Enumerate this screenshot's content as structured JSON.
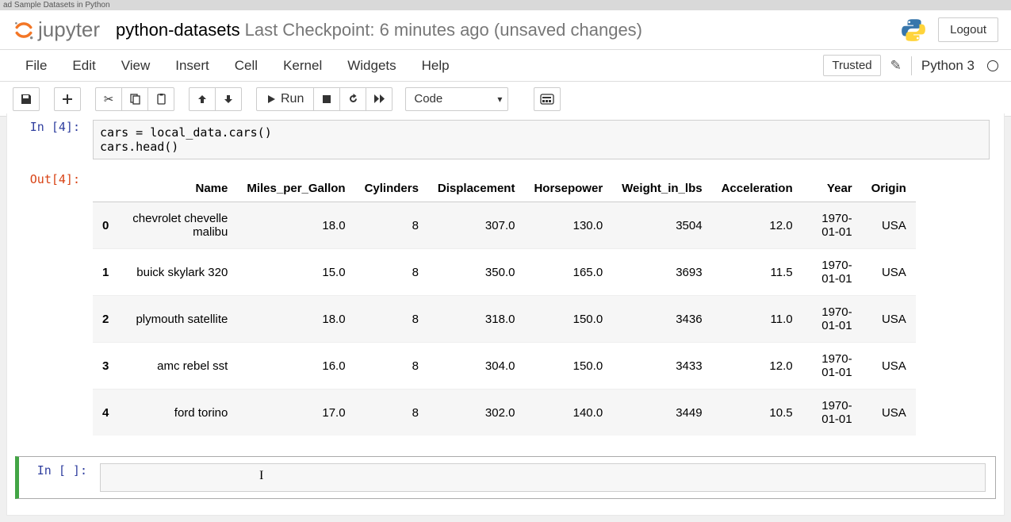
{
  "tab_strip": "ad Sample Datasets in Python",
  "header": {
    "logo_text": "jupyter",
    "notebook_name": "python-datasets",
    "checkpoint": "Last Checkpoint: 6 minutes ago  (unsaved changes)",
    "logout": "Logout"
  },
  "menubar": {
    "items": [
      "File",
      "Edit",
      "View",
      "Insert",
      "Cell",
      "Kernel",
      "Widgets",
      "Help"
    ],
    "trusted": "Trusted",
    "kernel": "Python 3"
  },
  "toolbar": {
    "run_label": "Run",
    "celltype": "Code"
  },
  "cells": {
    "in4_prompt": "In [4]:",
    "in4_code_line1": "cars = local_data.cars()",
    "in4_code_line2": "cars.head()",
    "out4_prompt": "Out[4]:",
    "empty_in_prompt": "In [ ]:"
  },
  "dataframe": {
    "columns": [
      "Name",
      "Miles_per_Gallon",
      "Cylinders",
      "Displacement",
      "Horsepower",
      "Weight_in_lbs",
      "Acceleration",
      "Year",
      "Origin"
    ],
    "rows": [
      {
        "idx": "0",
        "Name": "chevrolet chevelle malibu",
        "Miles_per_Gallon": "18.0",
        "Cylinders": "8",
        "Displacement": "307.0",
        "Horsepower": "130.0",
        "Weight_in_lbs": "3504",
        "Acceleration": "12.0",
        "Year": "1970-01-01",
        "Origin": "USA"
      },
      {
        "idx": "1",
        "Name": "buick skylark 320",
        "Miles_per_Gallon": "15.0",
        "Cylinders": "8",
        "Displacement": "350.0",
        "Horsepower": "165.0",
        "Weight_in_lbs": "3693",
        "Acceleration": "11.5",
        "Year": "1970-01-01",
        "Origin": "USA"
      },
      {
        "idx": "2",
        "Name": "plymouth satellite",
        "Miles_per_Gallon": "18.0",
        "Cylinders": "8",
        "Displacement": "318.0",
        "Horsepower": "150.0",
        "Weight_in_lbs": "3436",
        "Acceleration": "11.0",
        "Year": "1970-01-01",
        "Origin": "USA"
      },
      {
        "idx": "3",
        "Name": "amc rebel sst",
        "Miles_per_Gallon": "16.0",
        "Cylinders": "8",
        "Displacement": "304.0",
        "Horsepower": "150.0",
        "Weight_in_lbs": "3433",
        "Acceleration": "12.0",
        "Year": "1970-01-01",
        "Origin": "USA"
      },
      {
        "idx": "4",
        "Name": "ford torino",
        "Miles_per_Gallon": "17.0",
        "Cylinders": "8",
        "Displacement": "302.0",
        "Horsepower": "140.0",
        "Weight_in_lbs": "3449",
        "Acceleration": "10.5",
        "Year": "1970-01-01",
        "Origin": "USA"
      }
    ]
  }
}
